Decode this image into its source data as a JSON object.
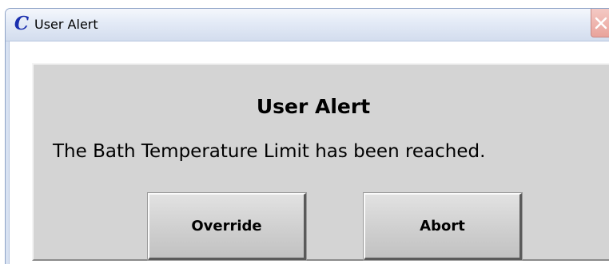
{
  "window": {
    "title": "User Alert",
    "app_icon_glyph": "C",
    "app_icon": "c-logo-icon"
  },
  "dialog": {
    "heading": "User Alert",
    "message": "The Bath Temperature Limit has been reached.",
    "buttons": {
      "override_label": "Override",
      "abort_label": "Abort"
    }
  },
  "colors": {
    "panel": "#d4d4d4",
    "titlebar": "#dfe7f5",
    "close_button": "#e9a39b",
    "app_icon": "#1a2fae"
  }
}
